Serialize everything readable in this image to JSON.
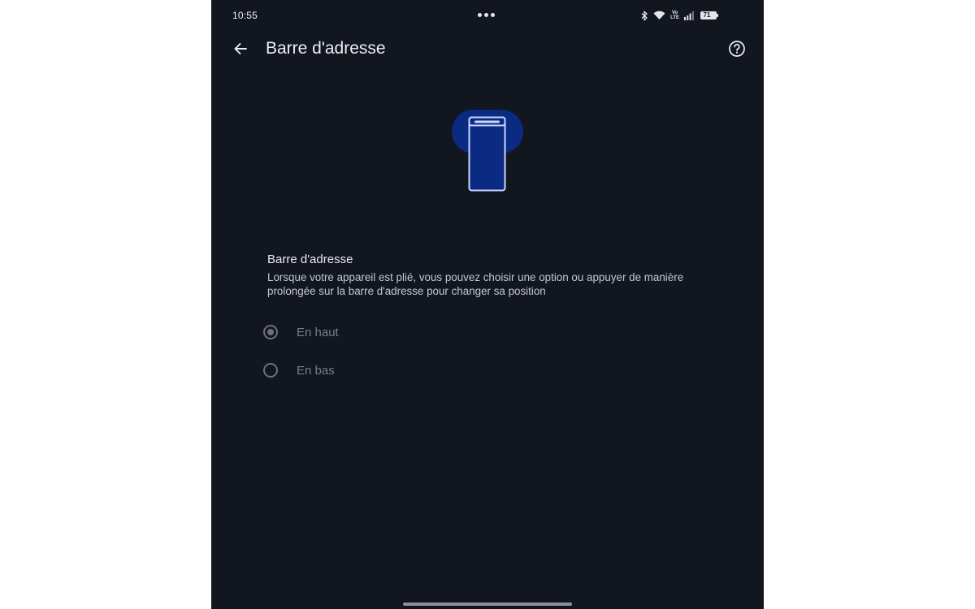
{
  "status_bar": {
    "time": "10:55",
    "volte_top": "Vo",
    "volte_bottom": "LTE",
    "battery": "71"
  },
  "app_bar": {
    "title": "Barre d'adresse",
    "back_icon": "arrow-back-icon",
    "help_icon": "help-circle-icon"
  },
  "illustration": {
    "icon": "phone-top-address-bar-icon",
    "accent_color": "#0b2a82",
    "outline_color": "#c9d6ff"
  },
  "section": {
    "title": "Barre d'adresse",
    "description": "Lorsque votre appareil est plié, vous pouvez choisir une option ou appuyer de manière prolongée sur la barre d'adresse pour changer sa position"
  },
  "options": [
    {
      "label": "En haut",
      "selected": true
    },
    {
      "label": "En bas",
      "selected": false
    }
  ],
  "colors": {
    "background": "#12161f",
    "text_primary": "#eceef2",
    "text_disabled": "#7a7d86"
  }
}
